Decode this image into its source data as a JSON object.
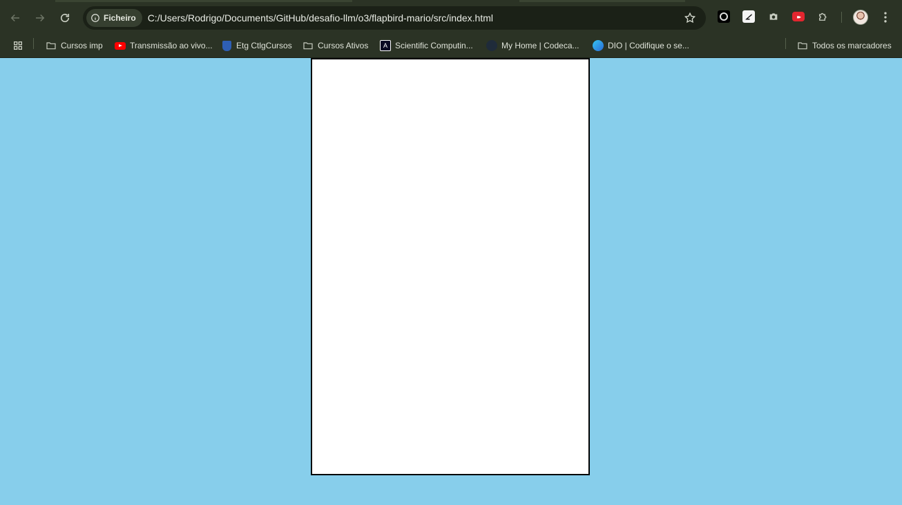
{
  "browser": {
    "address_bar": {
      "security_chip_label": "Ficheiro",
      "url": "C:/Users/Rodrigo/Documents/GitHub/desafio-llm/o3/flapbird-mario/src/index.html"
    },
    "toolbar_icons": [
      "back-icon",
      "forward-icon",
      "reload-icon",
      "info-icon",
      "star-icon",
      "extension-black-icon",
      "extension-white-icon",
      "camera-icon",
      "red-extension-icon",
      "puzzle-icon",
      "avatar",
      "menu-dots-icon"
    ]
  },
  "bookmarks": {
    "items": [
      {
        "label": "Cursos imp",
        "icon": "folder-icon"
      },
      {
        "label": "Transmissão ao vivo...",
        "icon": "youtube-icon"
      },
      {
        "label": "Etg CtlgCursos",
        "icon": "etg-icon"
      },
      {
        "label": "Cursos Ativos",
        "icon": "folder-icon"
      },
      {
        "label": "Scientific Computin...",
        "icon": "freecodecamp-icon"
      },
      {
        "label": "My Home | Codeca...",
        "icon": "codecademy-icon"
      },
      {
        "label": "DIO | Codifique o se...",
        "icon": "dio-icon"
      }
    ],
    "all_bookmarks_label": "Todos os marcadores"
  },
  "colors": {
    "toolbar_bg": "#2b3325",
    "page_bg": "#87ceeb",
    "canvas_bg": "#ffffff",
    "canvas_border": "#000000"
  }
}
